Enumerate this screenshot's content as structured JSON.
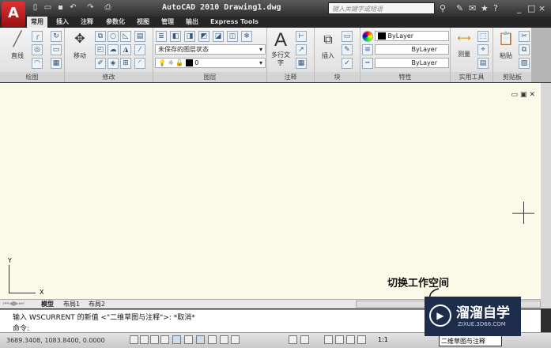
{
  "app": {
    "logo": "A",
    "title": "AutoCAD 2010  Drawing1.dwg",
    "search_placeholder": "键入关键字或短语"
  },
  "tabs": [
    "常用",
    "插入",
    "注释",
    "参数化",
    "视图",
    "管理",
    "输出",
    "Express Tools"
  ],
  "panels": {
    "draw": {
      "label": "绘图",
      "line": "直线"
    },
    "modify": {
      "label": "修改",
      "move": "移动"
    },
    "layers": {
      "label": "图层",
      "state": "未保存的图层状态",
      "layer": "0"
    },
    "annotation": {
      "label": "注释",
      "mtext": "多行文字"
    },
    "block": {
      "label": "块",
      "insert": "插入"
    },
    "properties": {
      "label": "特性",
      "color": "ByLayer",
      "linetype": "ByLayer",
      "lineweight": "ByLayer"
    },
    "utilities": {
      "label": "实用工具",
      "measure": "测量"
    },
    "clipboard": {
      "label": "剪贴板",
      "paste": "粘贴"
    }
  },
  "canvas": {
    "ucs_x": "X",
    "ucs_y": "Y",
    "annotation": "切换工作空间"
  },
  "layout_tabs": [
    "模型",
    "布局1",
    "布局2"
  ],
  "command": {
    "history": "输入 WSCURRENT 的新值 <\"二维草图与注释\">: *取消*",
    "prompt": "命令:"
  },
  "status": {
    "coords": "3689.3408, 1083.8400, 0.0000",
    "scale": "1:1",
    "workspace": "二维草图与注释"
  },
  "watermark": {
    "brand": "溜溜自学",
    "url": "ZIXUE.3D66.COM"
  }
}
